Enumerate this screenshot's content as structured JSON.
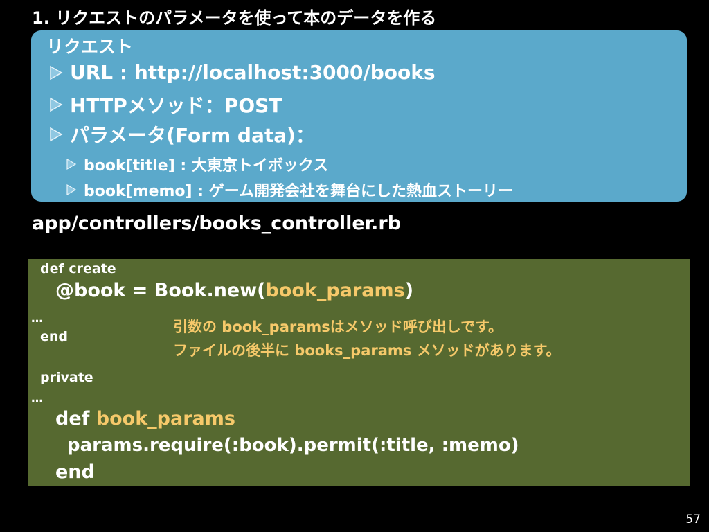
{
  "title": "1. リクエストのパラメータを使って本のデータを作る",
  "request": {
    "heading": "リクエスト",
    "items": [
      {
        "text": "URL : http://localhost:3000/books"
      },
      {
        "text": "HTTPメソッド：POST"
      },
      {
        "text": "パラメータ(Form data)："
      }
    ],
    "params": [
      {
        "text": "book[title] : 大東京トイボックス"
      },
      {
        "text": "book[memo] : ゲーム開発会社を舞台にした熱血ストーリー"
      }
    ]
  },
  "file_path": "app/controllers/books_controller.rb",
  "code": {
    "def_create": "def create",
    "assign_prefix": "@book = Book.new(",
    "assign_arg": "book_params",
    "assign_suffix": ")",
    "ellipsis_1": "…",
    "end_1": "end",
    "private": "private",
    "ellipsis_2": "…",
    "def_keyword": "def ",
    "def_name": "book_params",
    "params_line": "params.require(:book).permit(:title, :memo)",
    "end_2": "end"
  },
  "notes": {
    "line1": "引数の book_paramsはメソッド呼び出しです。",
    "line2": "ファイルの後半に books_params メソッドがあります。"
  },
  "page_number": "57",
  "colors": {
    "background": "#000000",
    "request_box": "#5ba9cb",
    "code_box": "#566930",
    "highlight": "#f6c96a"
  },
  "icons": {
    "bullet": "triangle-bullet-icon"
  }
}
